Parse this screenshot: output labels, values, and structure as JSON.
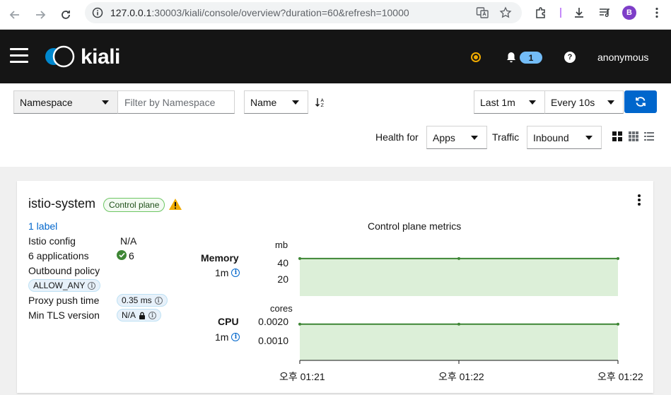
{
  "browser": {
    "url_host": "127.0.0.1",
    "url_rest": ":30003/kiali/console/overview?duration=60&refresh=10000",
    "profile_initial": "B"
  },
  "masthead": {
    "logo_text": "kiali",
    "notifications_count": "1",
    "help_label": "?",
    "user": "anonymous",
    "accent_color": "#0066cc",
    "status_color": "#f0ab00"
  },
  "toolbar": {
    "filter_type": "Namespace",
    "filter_placeholder": "Filter by Namespace",
    "sort_by": "Name",
    "duration": "Last 1m",
    "refresh_interval": "Every 10s",
    "health_for_label": "Health for",
    "health_for_value": "Apps",
    "traffic_label": "Traffic",
    "traffic_value": "Inbound"
  },
  "card": {
    "namespace": "istio-system",
    "badge": "Control plane",
    "labels_link": "1 label",
    "istio_config_label": "Istio config",
    "istio_config_value": "N/A",
    "applications_label": "6 applications",
    "applications_healthy": "6",
    "outbound_policy_label": "Outbound policy",
    "outbound_policy_value": "ALLOW_ANY",
    "proxy_push_label": "Proxy push time",
    "proxy_push_value": "0.35 ms",
    "min_tls_label": "Min TLS version",
    "min_tls_value": "N/A",
    "chart_title": "Control plane metrics",
    "memory_label": "Memory",
    "memory_duration": "1m",
    "memory_unit": "mb",
    "cpu_label": "CPU",
    "cpu_duration": "1m",
    "cpu_unit": "cores"
  },
  "chart_data": [
    {
      "type": "area",
      "title": "Memory",
      "ylabel": "mb",
      "yticks": [
        "40",
        "20"
      ],
      "x": [
        "오후 01:21",
        "오후 01:22",
        "오후 01:22"
      ],
      "values": [
        49,
        49,
        49
      ],
      "ylim": [
        0,
        60
      ],
      "grid": false,
      "color": "#3e8635"
    },
    {
      "type": "area",
      "title": "CPU",
      "ylabel": "cores",
      "yticks": [
        "0.0020",
        "0.0010"
      ],
      "x": [
        "오후 01:21",
        "오후 01:22",
        "오후 01:22"
      ],
      "values": [
        0.002,
        0.002,
        0.002
      ],
      "ylim": [
        0,
        0.0025
      ],
      "grid": false,
      "color": "#3e8635"
    }
  ]
}
